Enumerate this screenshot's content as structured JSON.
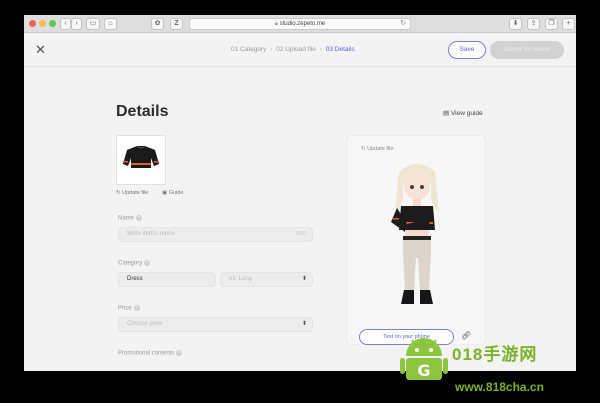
{
  "browser": {
    "url": "studio.zepeto.me",
    "tab_z": "Z",
    "back": "‹",
    "forward": "›"
  },
  "header": {
    "steps": [
      {
        "label": "01 Category"
      },
      {
        "label": "02 Upload file"
      },
      {
        "label": "03 Details"
      }
    ],
    "save_label": "Save",
    "submit_label": "Submit for review"
  },
  "page": {
    "title": "Details",
    "view_guide": "View guide",
    "thumb_links": {
      "update": "Update file",
      "guide": "Guide"
    }
  },
  "form": {
    "name": {
      "label": "Name",
      "placeholder": "Write item's name",
      "counter": "0/60"
    },
    "category": {
      "label": "Category",
      "value": "Dress",
      "sub_placeholder": "ex. Long"
    },
    "price": {
      "label": "Price",
      "placeholder": "Choose price"
    },
    "promo": {
      "label": "Promotional contents"
    }
  },
  "preview": {
    "update_label": "Update file",
    "test_label": "Test on your phone"
  },
  "watermark": {
    "line1": "018手游网",
    "line2": "www.818cha.cn"
  }
}
